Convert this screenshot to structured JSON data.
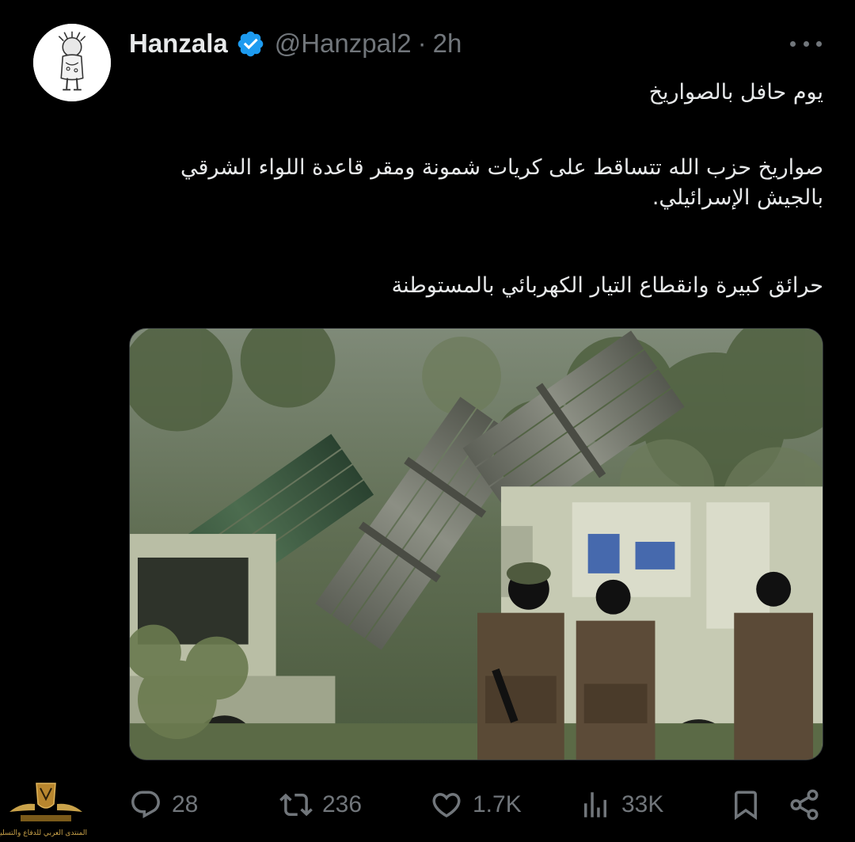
{
  "user": {
    "display_name": "Hanzala",
    "handle": "@Hanzpal2",
    "separator": "·",
    "time": "2h",
    "verified": true,
    "avatar_icon": "handala-figure-icon"
  },
  "tweet": {
    "paragraph1": "يوم حافل بالصواريخ",
    "paragraph2": "صواريخ حزب الله تتساقط على كريات شمونة ومقر قاعدة اللواء الشرقي بالجيش الإسرائيلي.",
    "paragraph3": "حرائق كبيرة وانقطاع التيار الكهربائي بالمستوطنة"
  },
  "media": {
    "icon": "rocket-launcher-trucks-photo"
  },
  "actions": {
    "replies": "28",
    "retweets": "236",
    "likes": "1.7K",
    "views": "33K"
  },
  "watermark": {
    "text": "المنتدى العربي للدفاع والتسليح"
  },
  "colors": {
    "background": "#000000",
    "text": "#e7e9ea",
    "muted": "#71767b",
    "verified_blue": "#1d9bf0"
  }
}
